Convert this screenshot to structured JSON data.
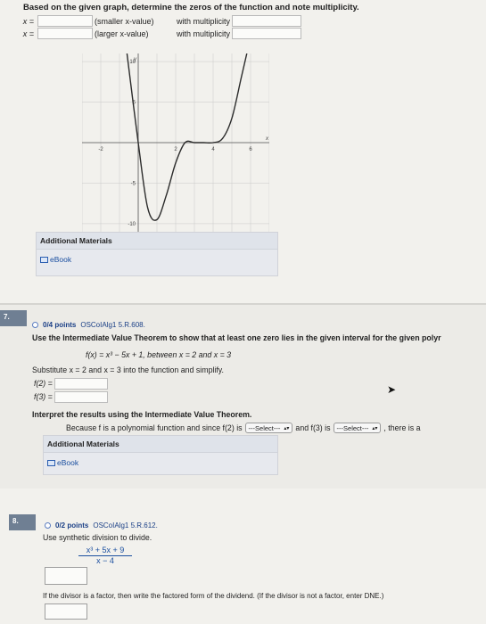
{
  "q_top": {
    "instruction": "Based on the given graph, determine the zeros of the function and note multiplicity.",
    "row1": {
      "x_label": "x =",
      "desc": "(smaller x-value)",
      "mult": "with multiplicity"
    },
    "row2": {
      "x_label": "x =",
      "desc": "(larger x-value)",
      "mult": "with multiplicity"
    },
    "additional_materials": "Additional Materials",
    "ebook": "eBook"
  },
  "chart_data": {
    "type": "line",
    "xlabel": "x",
    "ylabel": "y",
    "xlim": [
      -3,
      7
    ],
    "ylim": [
      -11,
      11
    ],
    "x_ticks": [
      "-2",
      "2",
      "4",
      "6"
    ],
    "y_ticks": [
      "10",
      "5",
      "-5",
      "-10"
    ],
    "grid": true,
    "curve": [
      {
        "x": -0.6,
        "y": 11
      },
      {
        "x": 0.0,
        "y": 0
      },
      {
        "x": 0.5,
        "y": -8
      },
      {
        "x": 1.0,
        "y": -9.5
      },
      {
        "x": 1.5,
        "y": -6.5
      },
      {
        "x": 2.0,
        "y": -2.5
      },
      {
        "x": 2.5,
        "y": 0
      },
      {
        "x": 3.0,
        "y": 0
      },
      {
        "x": 3.5,
        "y": 0
      },
      {
        "x": 4.0,
        "y": 0
      },
      {
        "x": 4.5,
        "y": 0.5
      },
      {
        "x": 5.0,
        "y": 3
      },
      {
        "x": 5.5,
        "y": 8
      },
      {
        "x": 5.8,
        "y": 11
      }
    ]
  },
  "q7": {
    "number": "7.",
    "points": "0/4 points",
    "source": "OSCoIAlg1 5.R.608.",
    "prompt": "Use the Intermediate Value Theorem to show that at least one zero lies in the given interval for the given polyr",
    "function": "f(x) = x³ − 5x + 1,  between  x = 2  and  x = 3",
    "substitute": "Substitute  x = 2  and  x = 3  into the function and simplify.",
    "f2_label": "f(2) =",
    "f3_label": "f(3) =",
    "interpret": "Interpret the results using the Intermediate Value Theorem.",
    "because": "Because f is a polynomial function and since f(2) is",
    "select1": "---Select---",
    "and_text": "and f(3) is",
    "select2": "---Select---",
    "tail": ", there is a",
    "additional_materials": "Additional Materials",
    "ebook": "eBook"
  },
  "q8": {
    "number": "8.",
    "points": "0/2 points",
    "source": "OSCoIAlg1 5.R.612.",
    "prompt": "Use synthetic division to divide.",
    "numerator": "x³ + 5x + 9",
    "denominator": "x − 4",
    "factor_prompt": "If the divisor is a factor, then write the factored form of the dividend. (If the divisor is not a factor, enter DNE.)"
  }
}
